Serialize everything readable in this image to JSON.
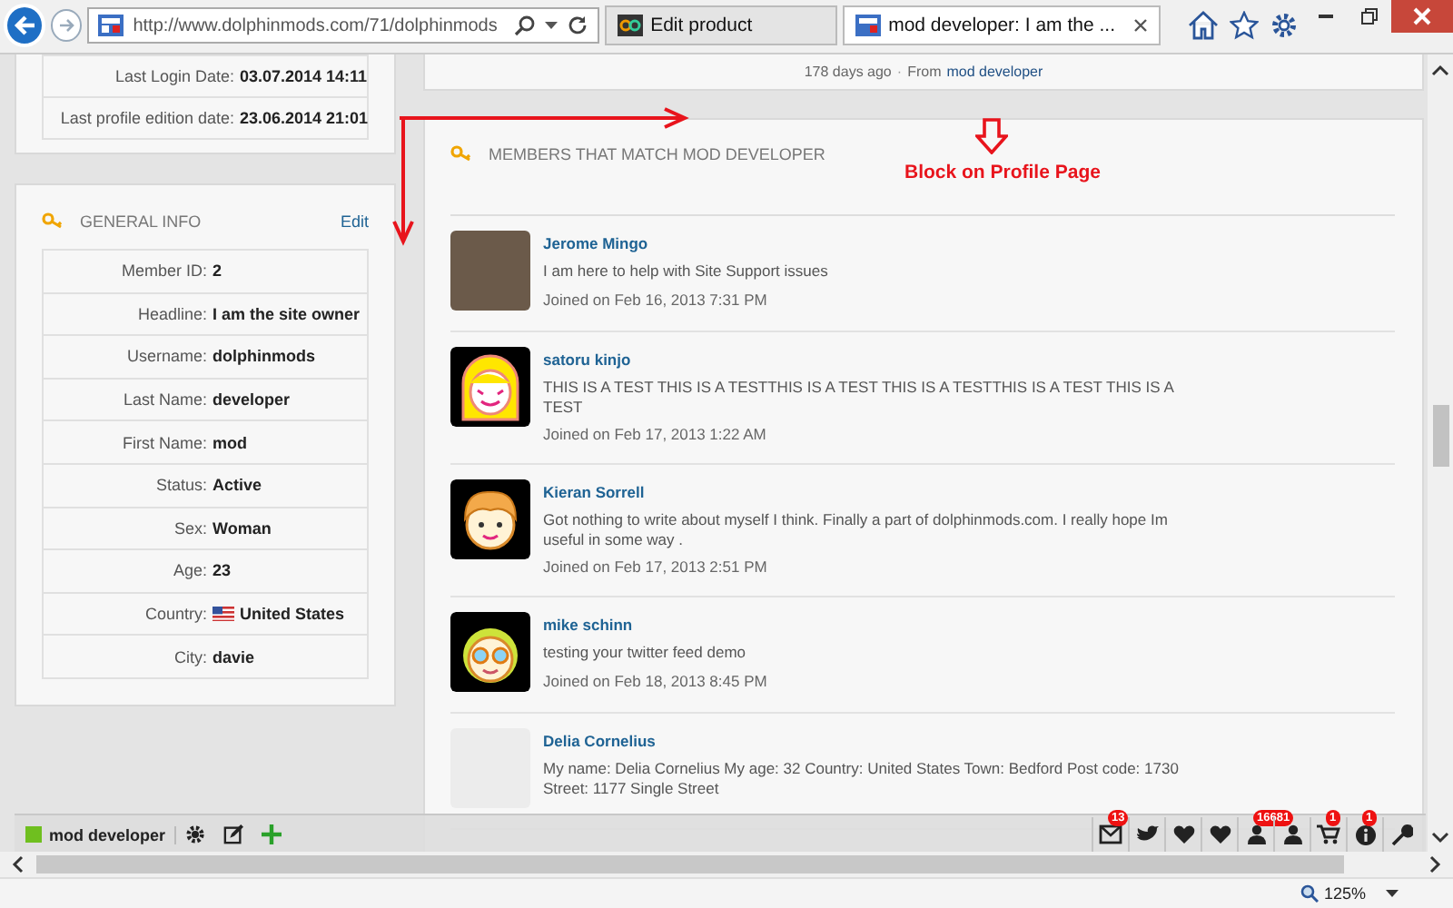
{
  "browser": {
    "url": "http://www.dolphinmods.com/71/dolphinmods",
    "tabs": [
      {
        "label": "Edit product",
        "selected": false
      },
      {
        "label": "mod developer: I am the ...",
        "selected": true
      }
    ]
  },
  "profile_card": {
    "rows": [
      {
        "label": "Last Login Date:",
        "value": "03.07.2014 14:11"
      },
      {
        "label": "Last profile edition date:",
        "value": "23.06.2014 21:01"
      }
    ]
  },
  "general_info": {
    "title": "GENERAL INFO",
    "edit": "Edit",
    "rows": [
      {
        "label": "Member ID:",
        "value": "2",
        "flag": false
      },
      {
        "label": "Headline:",
        "value": "I am the site owner",
        "flag": false
      },
      {
        "label": "Username:",
        "value": "dolphinmods",
        "flag": false
      },
      {
        "label": "Last Name:",
        "value": "developer",
        "flag": false
      },
      {
        "label": "First Name:",
        "value": "mod",
        "flag": false
      },
      {
        "label": "Status:",
        "value": "Active",
        "flag": false
      },
      {
        "label": "Sex:",
        "value": "Woman",
        "flag": false
      },
      {
        "label": "Age:",
        "value": "23",
        "flag": false
      },
      {
        "label": "Country:",
        "value": "United States",
        "flag": true
      },
      {
        "label": "City:",
        "value": "davie",
        "flag": false
      }
    ]
  },
  "activity": {
    "age": "178 days ago",
    "separator": "·",
    "from_label": "From",
    "from_link": "mod developer"
  },
  "annotation": {
    "text": "Block on Profile Page"
  },
  "members": {
    "title": "MEMBERS THAT MATCH MOD DEVELOPER",
    "items": [
      {
        "name": "Jerome Mingo",
        "about": "I am here to help with Site Support issues",
        "joined": "Joined on Feb 16, 2013 7:31 PM",
        "kind": "photo"
      },
      {
        "name": "satoru kinjo",
        "about": "THIS IS A TEST THIS IS A TESTTHIS IS A TEST THIS IS A TESTTHIS IS A TEST THIS IS A TEST",
        "joined": "Joined on Feb 17, 2013 1:22 AM",
        "kind": "girl"
      },
      {
        "name": "Kieran Sorrell",
        "about": "Got nothing to write about myself I think. Finally a part of dolphinmods.com. I really hope Im useful in some way .",
        "joined": "Joined on Feb 17, 2013 2:51 PM",
        "kind": "boy"
      },
      {
        "name": "mike schinn",
        "about": "testing your twitter feed demo",
        "joined": "Joined on Feb 18, 2013 8:45 PM",
        "kind": "glasses"
      },
      {
        "name": "Delia Cornelius",
        "about": "My name: Delia Cornelius My age: 32 Country: United States Town: Bedford Post code: 1730 Street: 1177 Single Street",
        "kind": "blank"
      }
    ]
  },
  "toolbar": {
    "user": "mod developer",
    "icons": [
      {
        "kind": "mail",
        "badge": "13"
      },
      {
        "kind": "bird"
      },
      {
        "kind": "heart"
      },
      {
        "kind": "heart"
      },
      {
        "kind": "person",
        "badge": "16681"
      },
      {
        "kind": "person"
      },
      {
        "kind": "cart",
        "badge": "1"
      },
      {
        "kind": "info",
        "badge": "1"
      },
      {
        "kind": "wrench"
      }
    ]
  },
  "status_bar": {
    "zoom": "125%"
  }
}
